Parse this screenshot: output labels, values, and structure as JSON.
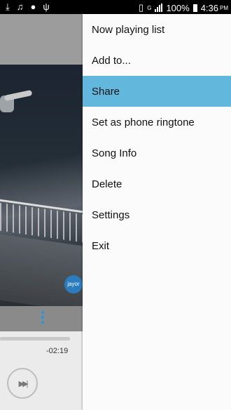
{
  "status_bar": {
    "icons_left": [
      "download-icon",
      "music-note-icon",
      "cat-icon",
      "usb-icon"
    ],
    "icons_right": [
      "vibrate-icon",
      "signal-icon"
    ],
    "network": "G",
    "battery": "100%",
    "time": "4:36",
    "ampm": "PM"
  },
  "player": {
    "elapsed_remaining": "-02:19",
    "next_icon": "next-track-icon",
    "badge_text": "jayor"
  },
  "menu": {
    "items": [
      {
        "label": "Now playing list"
      },
      {
        "label": "Add to..."
      },
      {
        "label": "Share",
        "active": true
      },
      {
        "label": "Set as phone ringtone"
      },
      {
        "label": "Song Info"
      },
      {
        "label": "Delete"
      },
      {
        "label": "Settings"
      },
      {
        "label": "Exit"
      }
    ],
    "accent_color": "#62b8dc"
  }
}
